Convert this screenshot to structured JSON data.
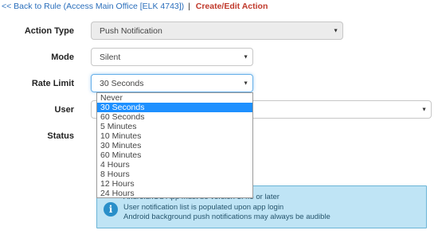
{
  "breadcrumb": {
    "back_link": "<< Back to Rule (Access Main Office [ELK 4743])",
    "separator": "|",
    "page_title": "Create/Edit Action"
  },
  "form": {
    "action_type": {
      "label": "Action Type",
      "value": "Push Notification"
    },
    "mode": {
      "label": "Mode",
      "value": "Silent"
    },
    "rate_limit": {
      "label": "Rate Limit",
      "value": "30 Seconds",
      "options": [
        "Never",
        "30 Seconds",
        "60 Seconds",
        "5 Minutes",
        "10 Minutes",
        "30 Minutes",
        "60 Minutes",
        "4 Hours",
        "8 Hours",
        "12 Hours",
        "24 Hours"
      ],
      "selected_index": 1
    },
    "user": {
      "label": "User",
      "value": ""
    },
    "status": {
      "label": "Status"
    }
  },
  "info_box": {
    "lines": [
      "Android/iOS App must be version 3.4.5 or later",
      "User notification list is populated upon app login",
      "Android background push notifications may always be audible"
    ]
  },
  "colors": {
    "link": "#2a6ebb",
    "title": "#c0392b",
    "selected": "#1e90ff",
    "info_bg": "#bfe4f5"
  }
}
